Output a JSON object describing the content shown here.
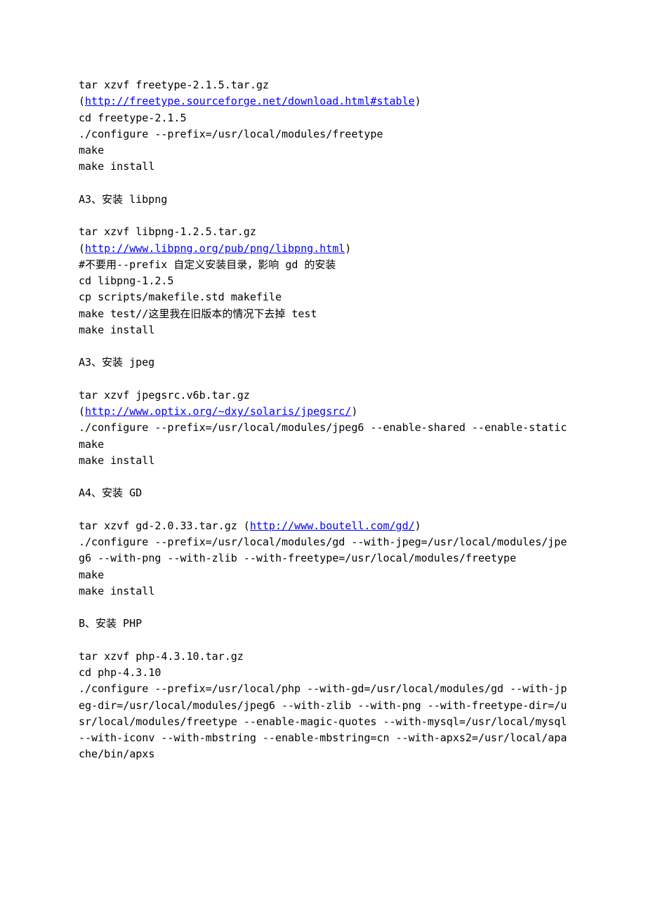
{
  "doc": {
    "sections": [
      {
        "lines": [
          {
            "parts": [
              {
                "t": "text",
                "v": "tar xzvf freetype-2.1.5.tar.gz"
              }
            ]
          },
          {
            "parts": [
              {
                "t": "text",
                "v": "("
              },
              {
                "t": "link",
                "v": "http://freetype.sourceforge.net/download.html#stable"
              },
              {
                "t": "text",
                "v": ")"
              }
            ]
          },
          {
            "parts": [
              {
                "t": "text",
                "v": "cd freetype-2.1.5"
              }
            ]
          },
          {
            "parts": [
              {
                "t": "text",
                "v": "./configure --prefix=/usr/local/modules/freetype"
              }
            ]
          },
          {
            "parts": [
              {
                "t": "text",
                "v": "make"
              }
            ]
          },
          {
            "parts": [
              {
                "t": "text",
                "v": "make install"
              }
            ]
          }
        ]
      },
      {
        "lines": [
          {
            "parts": [
              {
                "t": "text",
                "v": "A3、安装 libpng"
              }
            ]
          }
        ]
      },
      {
        "lines": [
          {
            "parts": [
              {
                "t": "text",
                "v": "tar xzvf libpng-1.2.5.tar.gz"
              }
            ]
          },
          {
            "parts": [
              {
                "t": "text",
                "v": "("
              },
              {
                "t": "link",
                "v": "http://www.libpng.org/pub/png/libpng.html"
              },
              {
                "t": "text",
                "v": ")"
              }
            ]
          },
          {
            "parts": [
              {
                "t": "text",
                "v": "#不要用--prefix 自定义安装目录，影响 gd 的安装"
              }
            ]
          },
          {
            "parts": [
              {
                "t": "text",
                "v": "cd libpng-1.2.5"
              }
            ]
          },
          {
            "parts": [
              {
                "t": "text",
                "v": "cp scripts/makefile.std makefile"
              }
            ]
          },
          {
            "parts": [
              {
                "t": "text",
                "v": "make test//这里我在旧版本的情况下去掉 test"
              }
            ]
          },
          {
            "parts": [
              {
                "t": "text",
                "v": "make install"
              }
            ]
          }
        ]
      },
      {
        "lines": [
          {
            "parts": [
              {
                "t": "text",
                "v": "A3、安装 jpeg"
              }
            ]
          }
        ]
      },
      {
        "lines": [
          {
            "parts": [
              {
                "t": "text",
                "v": "tar xzvf jpegsrc.v6b.tar.gz"
              }
            ]
          },
          {
            "parts": [
              {
                "t": "text",
                "v": "("
              },
              {
                "t": "link",
                "v": "http://www.optix.org/~dxy/solaris/jpegsrc/"
              },
              {
                "t": "text",
                "v": ")"
              }
            ]
          },
          {
            "parts": [
              {
                "t": "text",
                "v": "./configure --prefix=/usr/local/modules/jpeg6 --enable-shared --enable-static"
              }
            ]
          },
          {
            "parts": [
              {
                "t": "text",
                "v": "make"
              }
            ]
          },
          {
            "parts": [
              {
                "t": "text",
                "v": "make install"
              }
            ]
          }
        ]
      },
      {
        "lines": [
          {
            "parts": [
              {
                "t": "text",
                "v": "A4、安装 GD"
              }
            ]
          }
        ]
      },
      {
        "lines": [
          {
            "parts": [
              {
                "t": "text",
                "v": "tar xzvf gd-2.0.33.tar.gz ("
              },
              {
                "t": "link",
                "v": "http://www.boutell.com/gd/"
              },
              {
                "t": "text",
                "v": ")"
              }
            ]
          },
          {
            "parts": [
              {
                "t": "text",
                "v": "./configure --prefix=/usr/local/modules/gd --with-jpeg=/usr/local/modules/jpeg6 --with-png --with-zlib --with-freetype=/usr/local/modules/freetype"
              }
            ]
          },
          {
            "parts": [
              {
                "t": "text",
                "v": "make"
              }
            ]
          },
          {
            "parts": [
              {
                "t": "text",
                "v": "make install"
              }
            ]
          }
        ]
      },
      {
        "lines": [
          {
            "parts": [
              {
                "t": "text",
                "v": "B、安装 PHP"
              }
            ]
          }
        ]
      },
      {
        "lines": [
          {
            "parts": [
              {
                "t": "text",
                "v": "tar xzvf php-4.3.10.tar.gz"
              }
            ]
          },
          {
            "parts": [
              {
                "t": "text",
                "v": "cd php-4.3.10"
              }
            ]
          },
          {
            "parts": [
              {
                "t": "text",
                "v": "./configure --prefix=/usr/local/php --with-gd=/usr/local/modules/gd --with-jpeg-dir=/usr/local/modules/jpeg6 --with-zlib --with-png --with-freetype-dir=/usr/local/modules/freetype --enable-magic-quotes --with-mysql=/usr/local/mysql --with-iconv --with-mbstring --enable-mbstring=cn --with-apxs2=/usr/local/apache/bin/apxs"
              }
            ]
          }
        ]
      }
    ]
  }
}
